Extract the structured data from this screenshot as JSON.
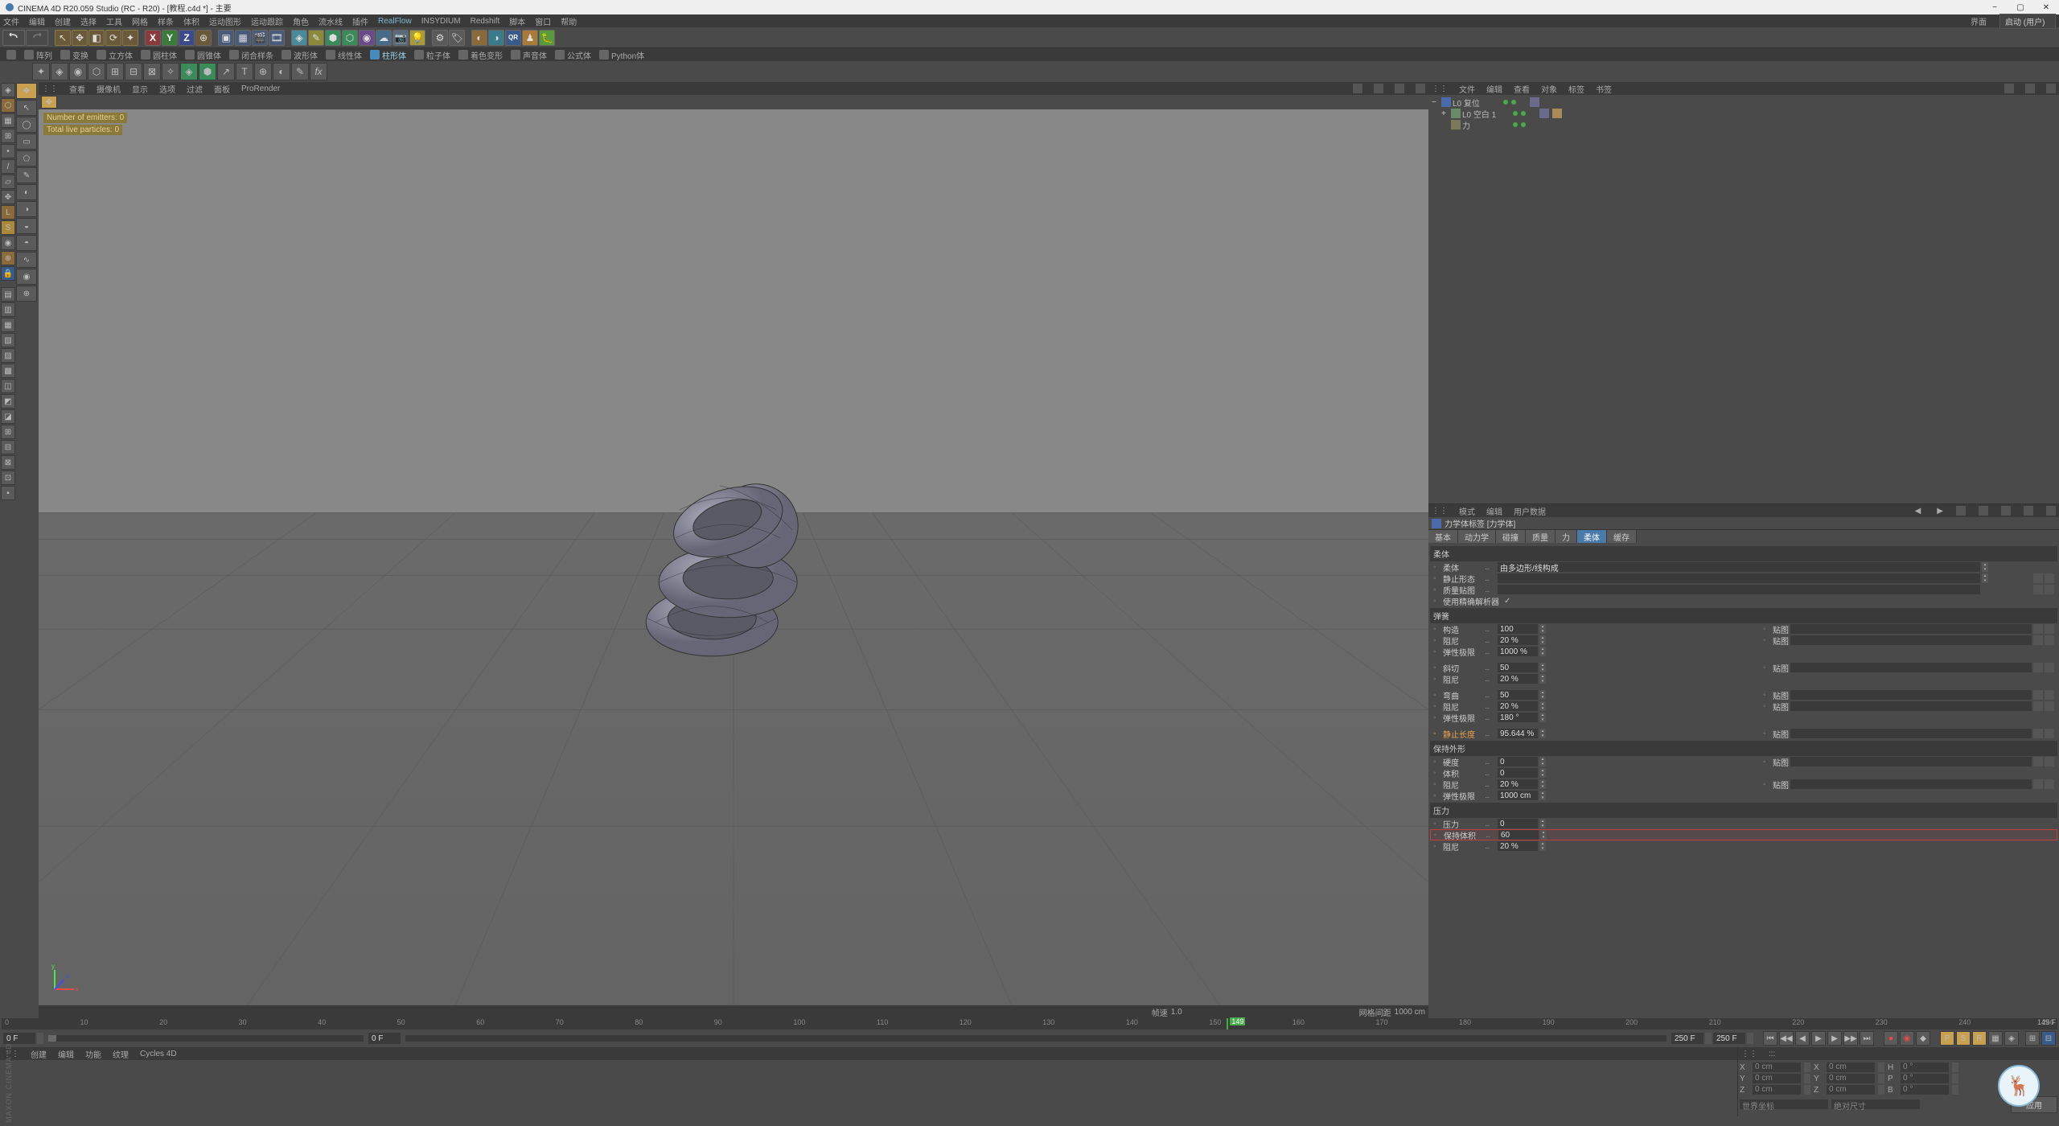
{
  "title": "CINEMA 4D R20.059 Studio (RC - R20) - [教程.c4d *] - 主要",
  "menubar": [
    "文件",
    "编辑",
    "创建",
    "选择",
    "工具",
    "网格",
    "样条",
    "体积",
    "运动图形",
    "运动跟踪",
    "角色",
    "流水线",
    "插件",
    "RealFlow",
    "INSYDIUM",
    "Redshift",
    "脚本",
    "窗口",
    "帮助"
  ],
  "menubar_right": {
    "layout_label": "界面",
    "layout_value": "启动 (用户)"
  },
  "axes": {
    "x": "X",
    "y": "Y",
    "z": "Z"
  },
  "toolbar2": [
    "阵列",
    "变换",
    "立方体",
    "圆柱体",
    "圆锥体",
    "闭合样条",
    "波形体",
    "线性体",
    "柱形体",
    "粒子体",
    "着色变形",
    "声音体",
    "公式体",
    "Python体"
  ],
  "viewport_menu": [
    "查看",
    "摄像机",
    "显示",
    "选项",
    "过滤",
    "面板",
    "ProRender"
  ],
  "viewport_caption": {
    "emitters": "Number of emitters: 0",
    "particles": "Total live particles: 0"
  },
  "viewport_status": {
    "speed_lbl": "帧速",
    "speed_val": "1.0",
    "grid_lbl": "网格间距",
    "grid_val": "1000 cm"
  },
  "objmenu": [
    "文件",
    "编辑",
    "查看",
    "对象",
    "标签",
    "书签"
  ],
  "objects": [
    {
      "name": "L0 复位",
      "indent": 0,
      "exp": "−",
      "tags": 1,
      "ico": "blue"
    },
    {
      "name": "L0 空白 1",
      "indent": 1,
      "exp": "+",
      "tags": 2,
      "ico": "green"
    },
    {
      "name": "力",
      "indent": 1,
      "exp": "",
      "tags": 0,
      "ico": "green"
    }
  ],
  "attr_menu": [
    "模式",
    "编辑",
    "用户数据"
  ],
  "attr_title": "力学体标签 [力学体]",
  "attr_tabs": [
    "基本",
    "动力学",
    "碰撞",
    "质量",
    "力",
    "柔体",
    "缓存"
  ],
  "attr_active_tab": 5,
  "soft": {
    "sec1": "柔体",
    "type_lbl": "柔体",
    "type_val": "由多边形/线构成",
    "rest_lbl": "静止形态",
    "rest_val": "",
    "mass_lbl": "质量贴图",
    "solver_lbl": "使用精确解析器",
    "solver_val": true,
    "sec2": "弹簧",
    "struct_lbl": "构造",
    "struct_val": "100",
    "struct_map": "贴图",
    "damp1_lbl": "阻尼",
    "damp1_val": "20 %",
    "damp1_map": "贴图",
    "limit1_lbl": "弹性极限",
    "limit1_val": "1000 %",
    "shear_lbl": "斜切",
    "shear_val": "50",
    "shear_map": "贴图",
    "damp2_lbl": "阻尼",
    "damp2_val": "20 %",
    "bend_lbl": "弯曲",
    "bend_val": "50",
    "bend_map": "贴图",
    "damp3_lbl": "阻尼",
    "damp3_val": "20 %",
    "damp3_map": "贴图",
    "limit2_lbl": "弹性极限",
    "limit2_val": "180 °",
    "restlen_lbl": "静止长度",
    "restlen_val": "95.644 %",
    "restlen_map": "贴图",
    "sec3": "保持外形",
    "hard_lbl": "硬度",
    "hard_val": "0",
    "hard_map": "贴图",
    "area_lbl": "体积",
    "area_val": "0",
    "damp4_lbl": "阻尼",
    "damp4_val": "20 %",
    "damp4_map": "贴图",
    "limit3_lbl": "弹性极限",
    "limit3_val": "1000 cm",
    "sec4": "压力",
    "press_lbl": "压力",
    "press_val": "0",
    "keepvol_lbl": "保持体积",
    "keepvol_val": "60",
    "damp5_lbl": "阻尼",
    "damp5_val": "20 %"
  },
  "timeline": {
    "ticks": [
      "0",
      "10",
      "20",
      "30",
      "40",
      "50",
      "60",
      "70",
      "80",
      "90",
      "100",
      "110",
      "120",
      "130",
      "140",
      "150",
      "160",
      "170",
      "180",
      "190",
      "200",
      "210",
      "220",
      "230",
      "240",
      "250"
    ],
    "head": 149,
    "head_lbl": "149 F",
    "startF": "0 F",
    "curF": "0 F",
    "endF": "250 F",
    "rangeF": "250 F"
  },
  "matmenu": [
    "创建",
    "编辑",
    "功能",
    "纹理",
    "Cycles 4D"
  ],
  "coord": {
    "x": "X",
    "y": "Y",
    "z": "Z",
    "pos": "0 cm",
    "scale_x": "X",
    "scale": "0 cm",
    "rot_h": "H",
    "rot": "0 °",
    "rot_p": "P",
    "rot_b": "B",
    "world": "世界坐标",
    "scale_mode": "绝对尺寸",
    "apply": "应用"
  },
  "path_hint": ":::"
}
